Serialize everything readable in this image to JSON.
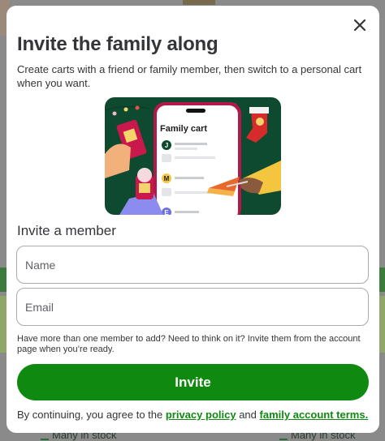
{
  "background": {
    "stock_left": "Many in stock",
    "stock_right": "Many in stock"
  },
  "modal": {
    "title": "Invite the family along",
    "description": "Create carts with a friend or family member, then switch to a personal cart when you want.",
    "illustration": {
      "card_title": "Family cart",
      "avatars": [
        "J",
        "M",
        "E"
      ]
    },
    "section_title": "Invite a member",
    "name_placeholder": "Name",
    "email_placeholder": "Email",
    "hint": "Have more than one member to add? Need to think on it? Invite them from the account page when you’re ready.",
    "invite_label": "Invite",
    "legal_prefix": "By continuing, you agree to the",
    "privacy_link": "privacy policy",
    "legal_and": "and",
    "terms_link": "family account terms."
  },
  "colors": {
    "accent": "#108910",
    "illustration_bg": "#0e4a2f",
    "phone_border": "#b3184a"
  }
}
